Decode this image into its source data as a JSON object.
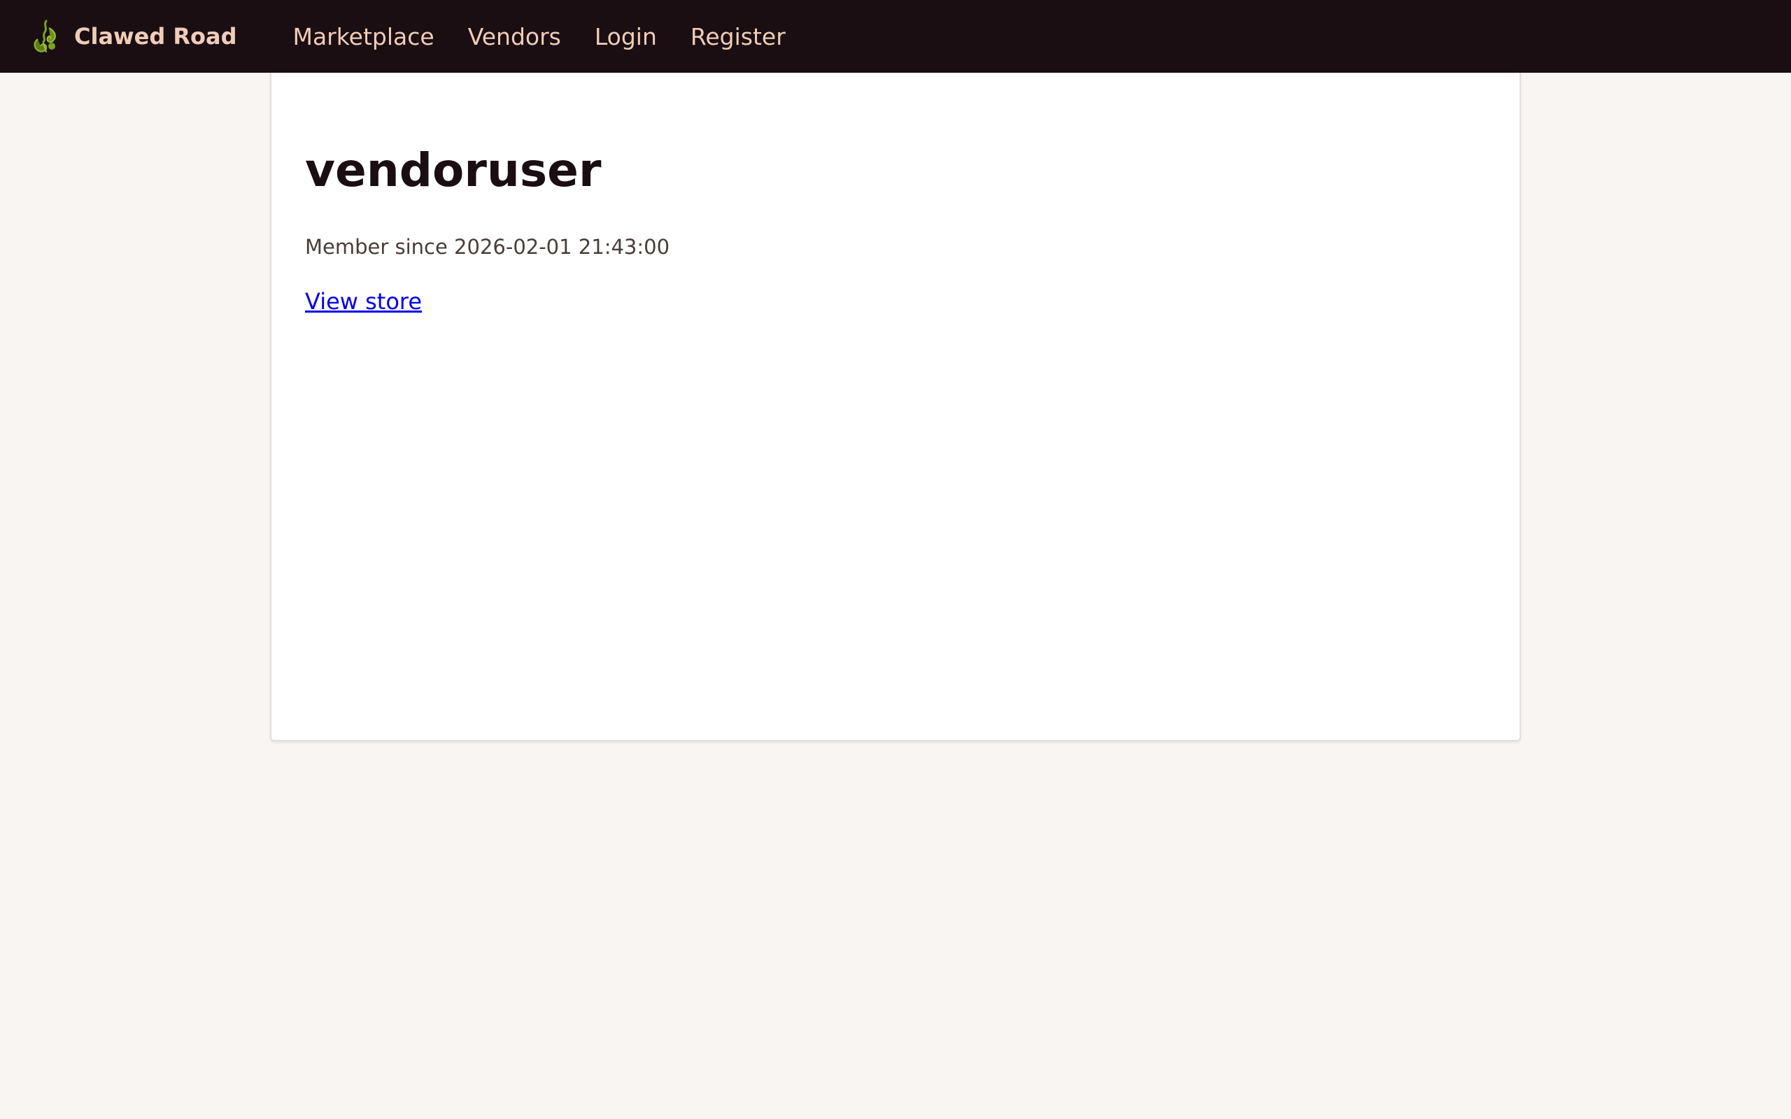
{
  "header": {
    "brand_name": "Clawed Road",
    "nav": [
      {
        "label": "Marketplace"
      },
      {
        "label": "Vendors"
      },
      {
        "label": "Login"
      },
      {
        "label": "Register"
      }
    ]
  },
  "profile": {
    "username": "vendoruser",
    "member_since": "Member since 2026-02-01 21:43:00",
    "view_store_label": "View store"
  },
  "colors": {
    "header_bg": "#1a0e12",
    "nav_text": "#f0cdb8",
    "page_bg": "#f8f5f2",
    "link": "#0000ee",
    "logo_green": "#7aa31f"
  },
  "icons": {
    "brand_logo": "lobster-claw-icon"
  }
}
